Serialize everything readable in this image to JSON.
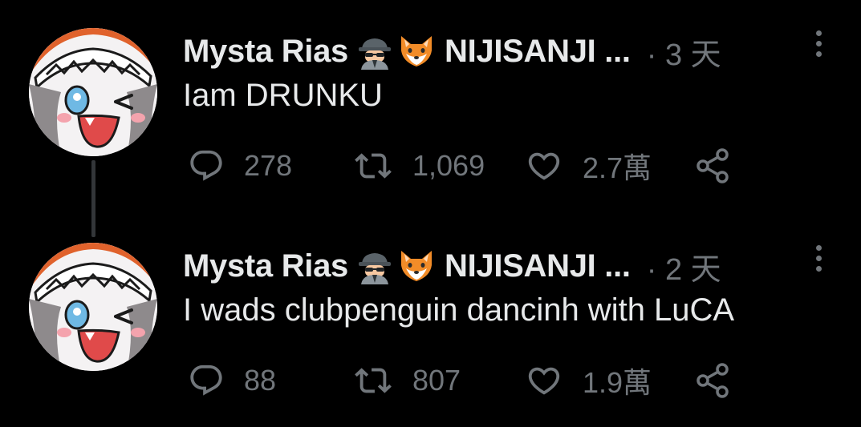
{
  "tweets": [
    {
      "display_name": "Mysta Rias",
      "org_name": "NIJISANJI ...",
      "time": "· 3 天",
      "text": "Iam DRUNKU",
      "replies": "278",
      "retweets": "1,069",
      "likes": "2.7萬",
      "icons": [
        "spy-emoji-icon",
        "fox-emoji-icon",
        "more-options-icon",
        "reply-icon",
        "retweet-icon",
        "like-icon",
        "share-icon"
      ]
    },
    {
      "display_name": "Mysta Rias",
      "org_name": "NIJISANJI ...",
      "time": "· 2 天",
      "text": "I wads clubpenguin dancinh with LuCA",
      "replies": "88",
      "retweets": "807",
      "likes": "1.9萬",
      "icons": [
        "spy-emoji-icon",
        "fox-emoji-icon",
        "more-options-icon",
        "reply-icon",
        "retweet-icon",
        "like-icon",
        "share-icon"
      ]
    }
  ],
  "colors": {
    "background": "#000000",
    "primary_text": "#e7e9ea",
    "secondary_text": "#71767b",
    "thread_line": "#333639"
  }
}
